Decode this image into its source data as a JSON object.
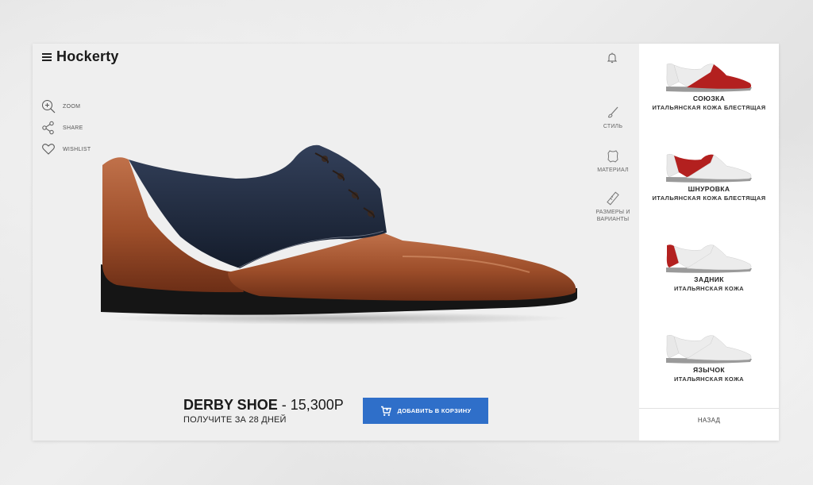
{
  "app": {
    "brand": "Hockerty",
    "menu_icon": "hamburger-icon",
    "bell_icon": "bell-icon"
  },
  "left_actions": [
    {
      "icon": "zoom-in-icon",
      "label": "ZOOM"
    },
    {
      "icon": "share-icon",
      "label": "SHARE"
    },
    {
      "icon": "heart-icon",
      "label": "WISHLIST"
    }
  ],
  "right_tools": [
    {
      "icon": "brush-icon",
      "label": "СТИЛЬ"
    },
    {
      "icon": "leather-icon",
      "label": "МАТЕРИАЛ"
    },
    {
      "icon": "ruler-icon",
      "label": "РАЗМЕРЫ И ВАРИАНТЫ"
    }
  ],
  "product": {
    "name": "DERBY SHOE",
    "price": "- 15,300Р",
    "delivery": "ПОЛУЧИТЕ ЗА 28 ДНЕЙ",
    "add_to_cart": "ДОБАВИТЬ В КОРЗИНУ",
    "cart_icon": "cart-icon"
  },
  "sidebar": {
    "options": [
      {
        "title": "СОЮЗКА",
        "subtitle": "ИТАЛЬЯНСКАЯ КОЖА БЛЕСТЯЩАЯ"
      },
      {
        "title": "ШНУРОВКА",
        "subtitle": "ИТАЛЬЯНСКАЯ КОЖА БЛЕСТЯЩАЯ"
      },
      {
        "title": "ЗАДНИК",
        "subtitle": "ИТАЛЬЯНСКАЯ КОЖА"
      },
      {
        "title": "ЯЗЫЧОК",
        "subtitle": "ИТАЛЬЯНСКАЯ КОЖА"
      }
    ],
    "back_label": "НАЗАД"
  },
  "colors": {
    "accent_button": "#2f6fc9",
    "highlight_red": "#b3201f",
    "shoe_brown": "#9a4f2a",
    "shoe_navy": "#1f2a3d"
  }
}
